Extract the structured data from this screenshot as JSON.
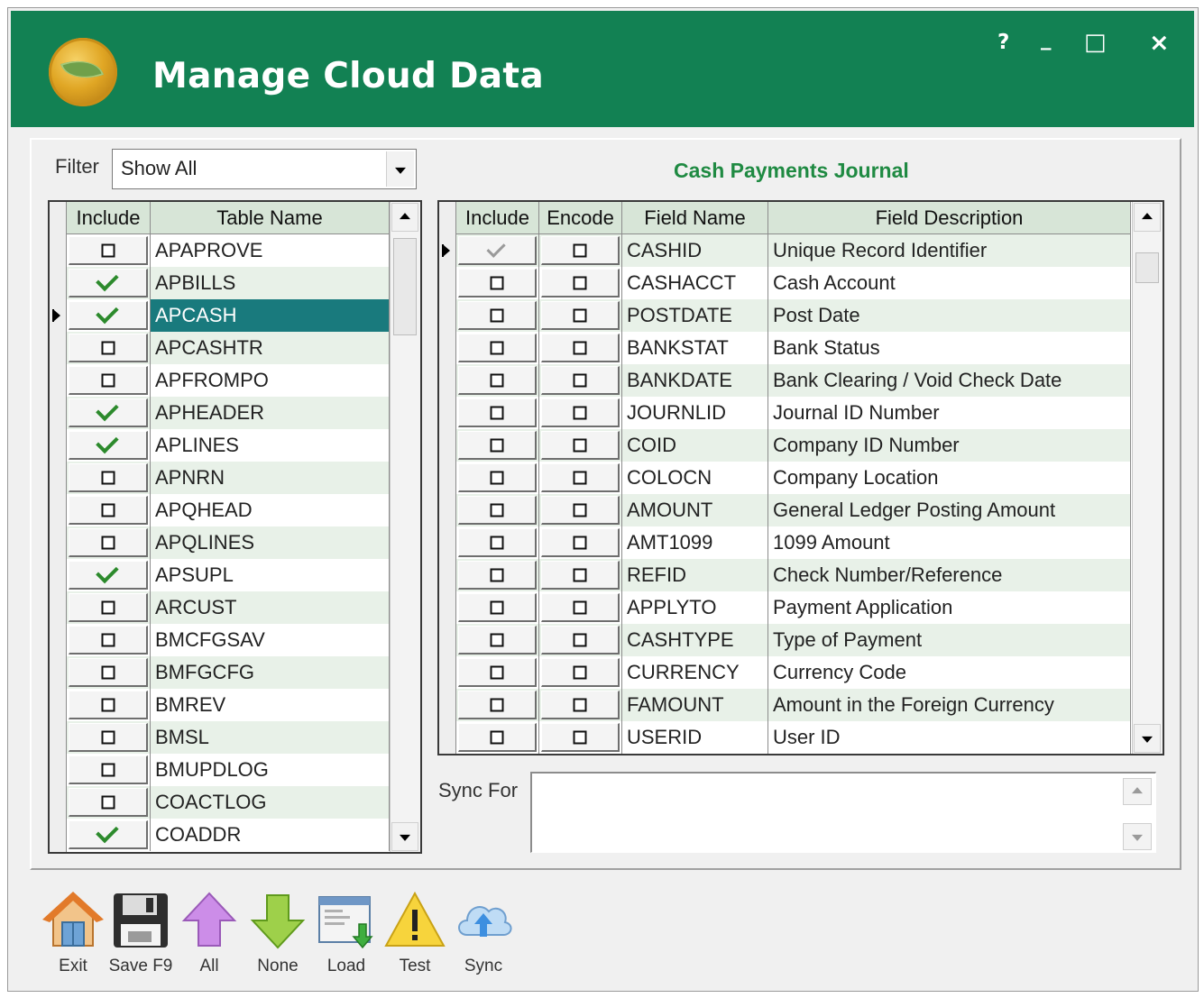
{
  "window": {
    "title": "Manage Cloud Data",
    "controls": {
      "help": "?",
      "minimize": "_",
      "maximize": "□",
      "close": "×"
    }
  },
  "filter": {
    "label": "Filter",
    "value": "Show All"
  },
  "tables_grid": {
    "headers": {
      "include": "Include",
      "table_name": "Table Name"
    },
    "rows": [
      {
        "include": false,
        "name": "APAPROVE"
      },
      {
        "include": true,
        "name": "APBILLS"
      },
      {
        "include": true,
        "name": "APCASH",
        "selected": true
      },
      {
        "include": false,
        "name": "APCASHTR"
      },
      {
        "include": false,
        "name": "APFROMPO"
      },
      {
        "include": true,
        "name": "APHEADER"
      },
      {
        "include": true,
        "name": "APLINES"
      },
      {
        "include": false,
        "name": "APNRN"
      },
      {
        "include": false,
        "name": "APQHEAD"
      },
      {
        "include": false,
        "name": "APQLINES"
      },
      {
        "include": true,
        "name": "APSUPL"
      },
      {
        "include": false,
        "name": "ARCUST"
      },
      {
        "include": false,
        "name": "BMCFGSAV"
      },
      {
        "include": false,
        "name": "BMFGCFG"
      },
      {
        "include": false,
        "name": "BMREV"
      },
      {
        "include": false,
        "name": "BMSL"
      },
      {
        "include": false,
        "name": "BMUPDLOG"
      },
      {
        "include": false,
        "name": "COACTLOG"
      },
      {
        "include": true,
        "name": "COADDR"
      }
    ]
  },
  "journal_title": "Cash Payments Journal",
  "fields_grid": {
    "headers": {
      "include": "Include",
      "encode": "Encode",
      "field_name": "Field Name",
      "field_description": "Field Description"
    },
    "rows": [
      {
        "include": "grey",
        "encode": false,
        "name": "CASHID",
        "desc": "Unique Record Identifier",
        "current": true
      },
      {
        "include": false,
        "encode": false,
        "name": "CASHACCT",
        "desc": "Cash Account"
      },
      {
        "include": false,
        "encode": false,
        "name": "POSTDATE",
        "desc": "Post Date"
      },
      {
        "include": false,
        "encode": false,
        "name": "BANKSTAT",
        "desc": "Bank Status"
      },
      {
        "include": false,
        "encode": false,
        "name": "BANKDATE",
        "desc": "Bank Clearing / Void Check Date"
      },
      {
        "include": false,
        "encode": false,
        "name": "JOURNLID",
        "desc": "Journal ID Number"
      },
      {
        "include": false,
        "encode": false,
        "name": "COID",
        "desc": "Company ID Number"
      },
      {
        "include": false,
        "encode": false,
        "name": "COLOCN",
        "desc": "Company Location"
      },
      {
        "include": false,
        "encode": false,
        "name": "AMOUNT",
        "desc": "General Ledger Posting Amount"
      },
      {
        "include": false,
        "encode": false,
        "name": "AMT1099",
        "desc": "1099 Amount"
      },
      {
        "include": false,
        "encode": false,
        "name": "REFID",
        "desc": "Check Number/Reference"
      },
      {
        "include": false,
        "encode": false,
        "name": "APPLYTO",
        "desc": "Payment Application"
      },
      {
        "include": false,
        "encode": false,
        "name": "CASHTYPE",
        "desc": "Type of Payment"
      },
      {
        "include": false,
        "encode": false,
        "name": "CURRENCY",
        "desc": "Currency Code"
      },
      {
        "include": false,
        "encode": false,
        "name": "FAMOUNT",
        "desc": "Amount in the Foreign Currency"
      },
      {
        "include": false,
        "encode": false,
        "name": "USERID",
        "desc": "User ID"
      }
    ]
  },
  "sync_for": {
    "label": "Sync For",
    "value": ""
  },
  "toolbar": [
    {
      "label": "Exit",
      "icon": "home-icon"
    },
    {
      "label": "Save F9",
      "icon": "floppy-disk-icon"
    },
    {
      "label": "All",
      "icon": "arrow-up-icon"
    },
    {
      "label": "None",
      "icon": "arrow-down-icon"
    },
    {
      "label": "Load",
      "icon": "load-window-icon"
    },
    {
      "label": "Test",
      "icon": "warning-icon"
    },
    {
      "label": "Sync",
      "icon": "cloud-upload-icon"
    }
  ],
  "colors": {
    "titlebar": "#128153",
    "accent_text": "#1f8a42",
    "selection": "#197a7d",
    "check": "#2c8a2c",
    "row_alt": "#e8f1e8",
    "header": "#d7e5d7"
  }
}
